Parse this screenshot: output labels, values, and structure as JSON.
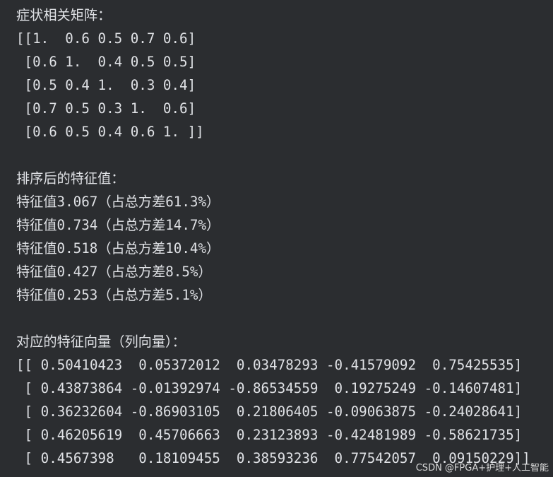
{
  "console": {
    "lines": [
      "症状相关矩阵：",
      "[[1.  0.6 0.5 0.7 0.6]",
      " [0.6 1.  0.4 0.5 0.5]",
      " [0.5 0.4 1.  0.3 0.4]",
      " [0.7 0.5 0.3 1.  0.6]",
      " [0.6 0.5 0.4 0.6 1. ]]",
      "",
      "排序后的特征值：",
      "特征值3.067（占总方差61.3%）",
      "特征值0.734（占总方差14.7%）",
      "特征值0.518（占总方差10.4%）",
      "特征值0.427（占总方差8.5%）",
      "特征值0.253（占总方差5.1%）",
      "",
      "对应的特征向量（列向量）：",
      "[[ 0.50410423  0.05372012  0.03478293 -0.41579092  0.75425535]",
      " [ 0.43873864 -0.01392974 -0.86534559  0.19275249 -0.14607481]",
      " [ 0.36232604 -0.86903105  0.21806405 -0.09063875 -0.24028641]",
      " [ 0.46205619  0.45706663  0.23123893 -0.42481989 -0.58621735]",
      " [ 0.4567398   0.18109455  0.38593236  0.77542057  0.09150229]]"
    ]
  },
  "watermark": "CSDN @FPGA+护理+人工智能",
  "colors": {
    "background": "#2b2d30",
    "text": "#dfe1e5"
  }
}
